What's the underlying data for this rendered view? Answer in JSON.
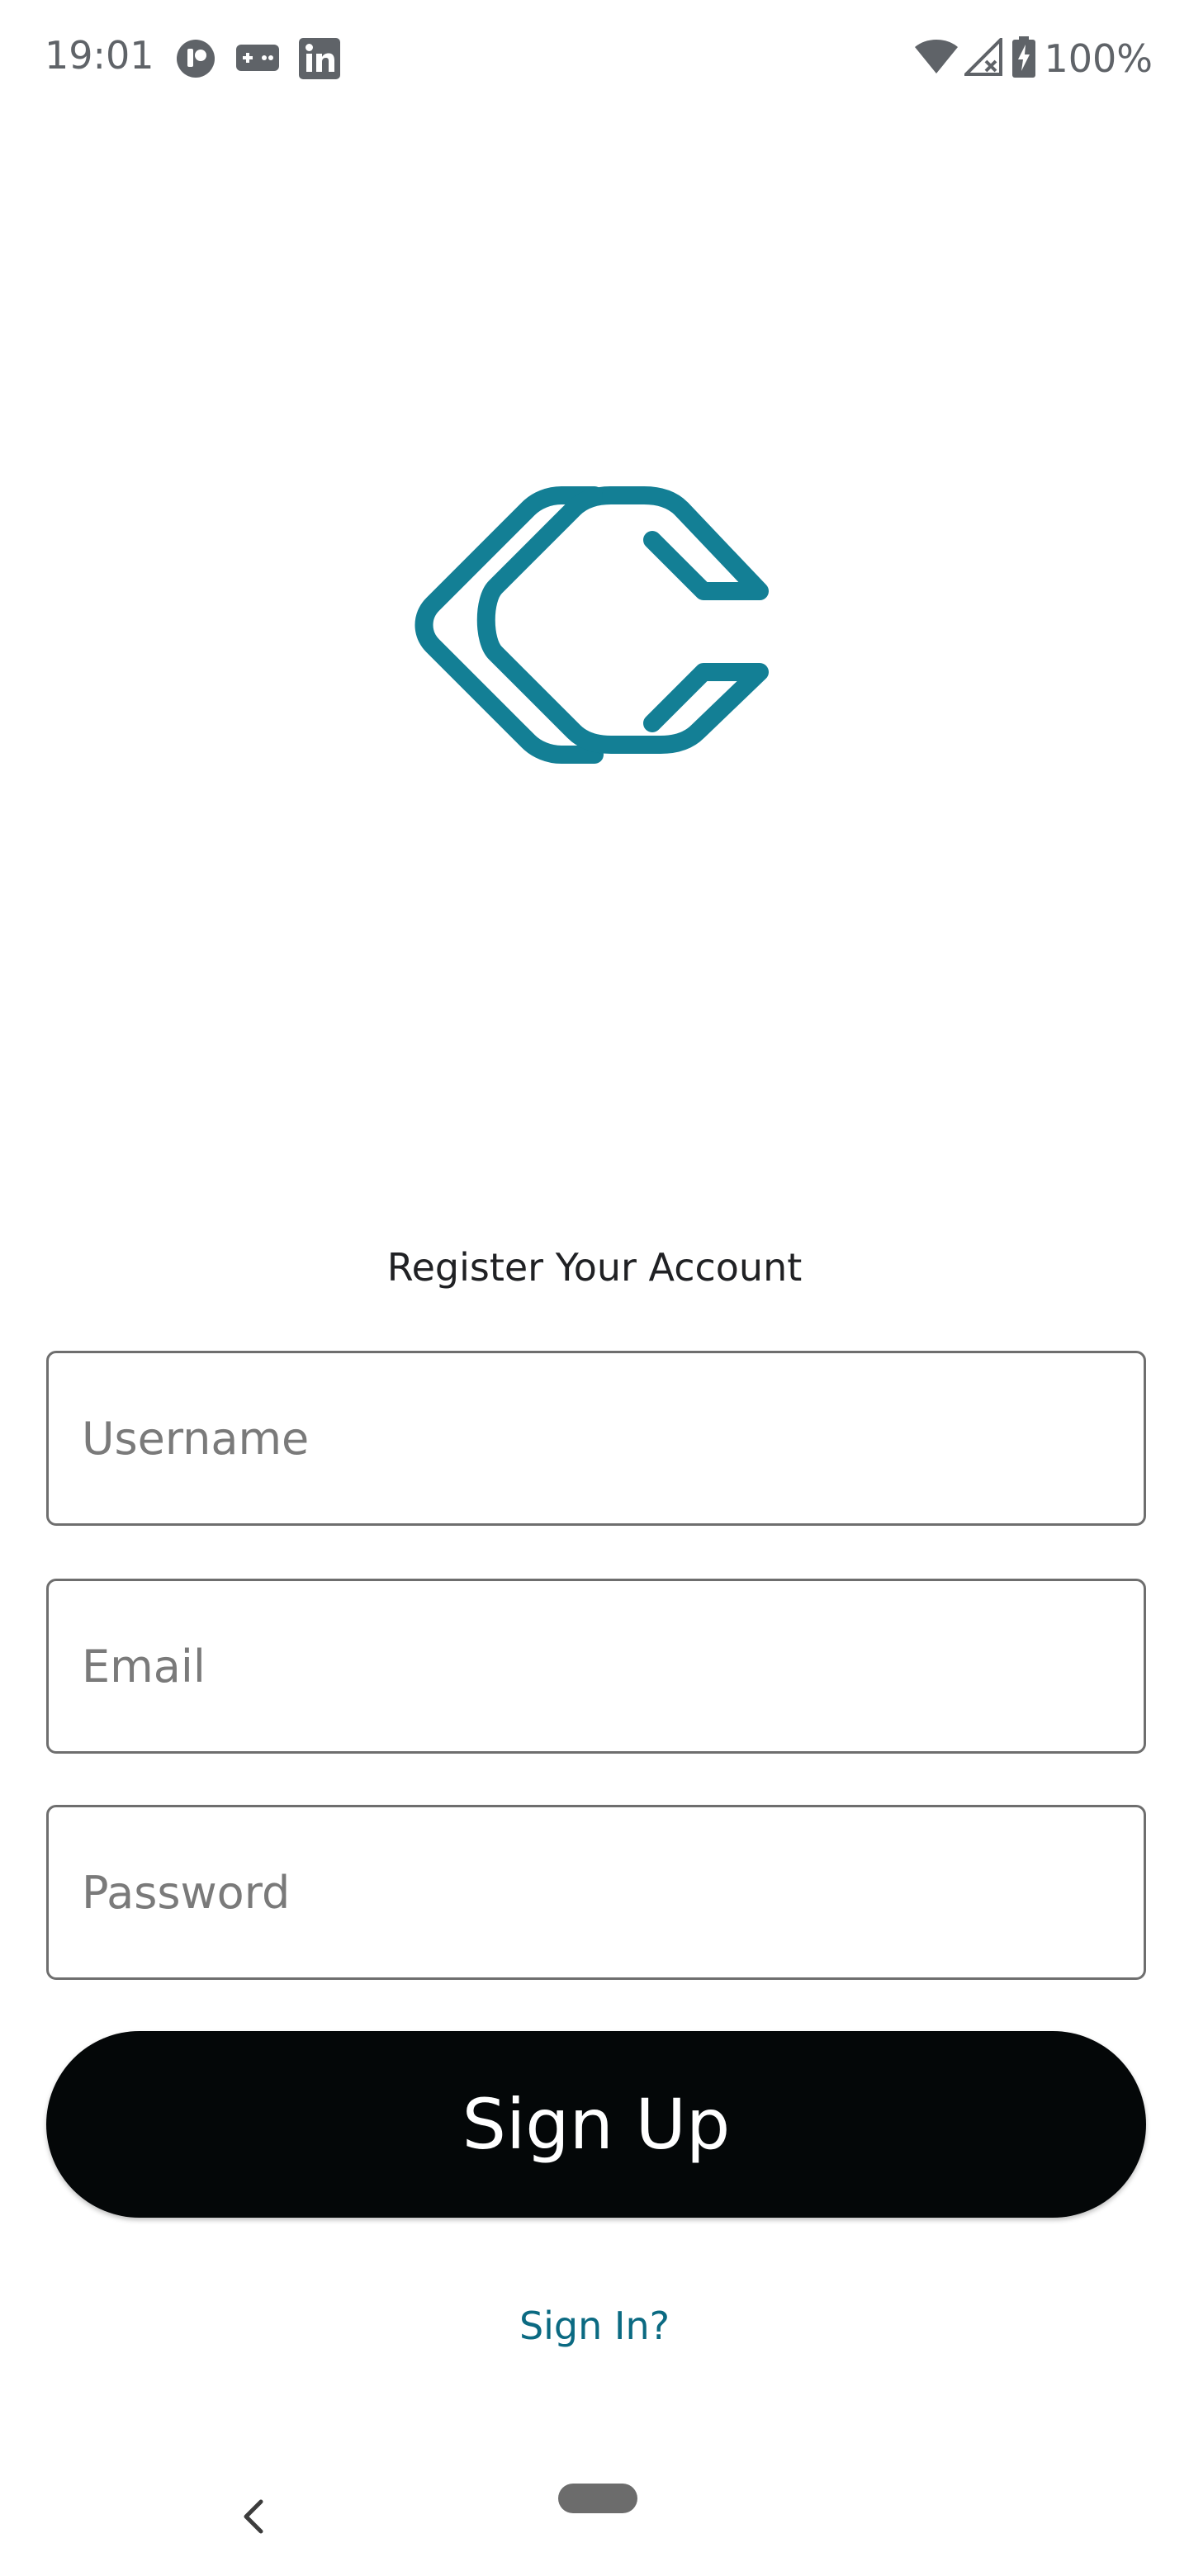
{
  "status_bar": {
    "time": "19:01",
    "battery": "100%",
    "icons": [
      "app-notification-icon",
      "controller-icon",
      "linkedin-icon",
      "wifi-icon",
      "no-signal-icon",
      "battery-charging-icon"
    ]
  },
  "logo": {
    "icon": "c-logo-icon",
    "color": "#137f95"
  },
  "form": {
    "title": "Register Your Account",
    "username_placeholder": "Username",
    "email_placeholder": "Email",
    "password_placeholder": "Password",
    "signup_label": "Sign Up",
    "signin_link": "Sign In?"
  },
  "colors": {
    "accent": "#137f95",
    "button": "#040708",
    "link": "#0b6a82"
  },
  "nav_bar": {
    "icons": [
      "back-icon",
      "home-pill-icon"
    ]
  }
}
